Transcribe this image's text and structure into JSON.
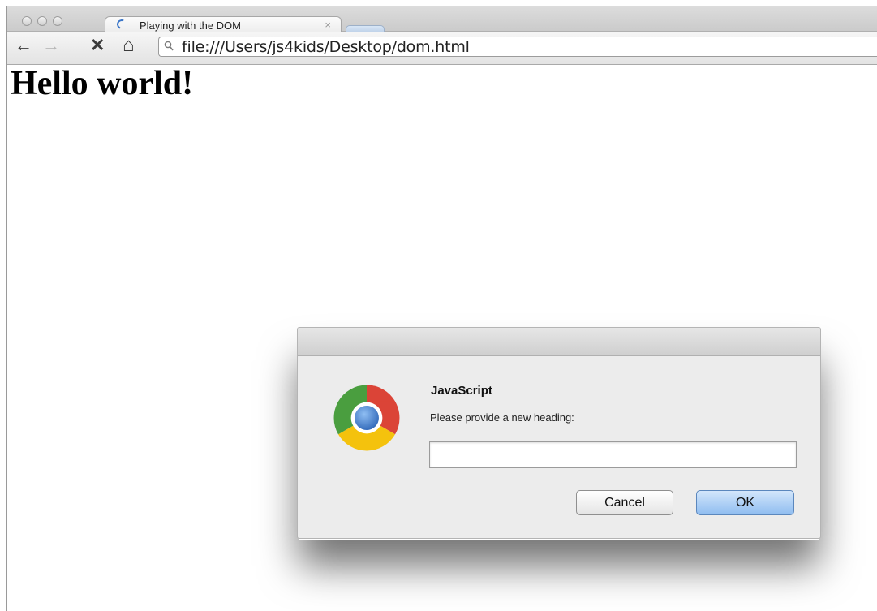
{
  "browser": {
    "tab": {
      "title": "Playing with the DOM",
      "close_glyph": "×"
    },
    "toolbar": {
      "back_glyph": "←",
      "forward_glyph": "→",
      "stop_glyph": "✕",
      "home_glyph": "⌂"
    },
    "omnibox": {
      "url": "file:///Users/js4kids/Desktop/dom.html"
    }
  },
  "page": {
    "heading": "Hello world!"
  },
  "dialog": {
    "title": "JavaScript",
    "message": "Please provide a new heading:",
    "input_value": "",
    "cancel_label": "Cancel",
    "ok_label": "OK"
  },
  "colors": {
    "accent_blue": "#8fbdf0",
    "chrome_red": "#db4437",
    "chrome_green": "#4a9e3f",
    "chrome_yellow": "#f4c20d",
    "chrome_blue": "#3c78c8"
  }
}
